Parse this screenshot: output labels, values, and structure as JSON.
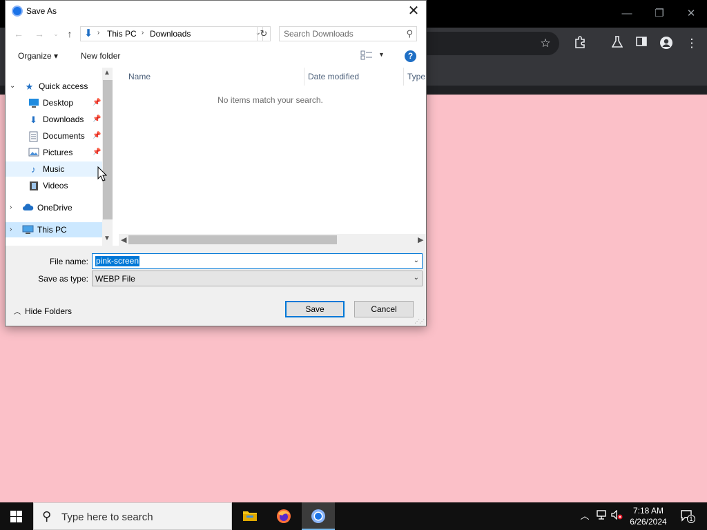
{
  "browser": {
    "window_controls": {
      "minimize": "—",
      "restore": "❐",
      "close": "✕"
    }
  },
  "dialog": {
    "title": "Save As",
    "close_glyph": "✕",
    "address": {
      "crumbs": [
        "This PC",
        "Downloads"
      ]
    },
    "search": {
      "placeholder": "Search Downloads"
    },
    "commands": {
      "organize": "Organize ▾",
      "new_folder": "New folder"
    },
    "help_glyph": "?",
    "nav_tree": {
      "quick_access": "Quick access",
      "items": [
        {
          "label": "Desktop"
        },
        {
          "label": "Downloads"
        },
        {
          "label": "Documents"
        },
        {
          "label": "Pictures"
        },
        {
          "label": "Music"
        },
        {
          "label": "Videos"
        }
      ],
      "onedrive": "OneDrive",
      "this_pc": "This PC"
    },
    "columns": {
      "name": "Name",
      "date_modified": "Date modified",
      "type": "Type"
    },
    "empty_message": "No items match your search.",
    "file_name_label": "File name:",
    "file_name_value": "pink-screen",
    "save_type_label": "Save as type:",
    "save_type_value": "WEBP File",
    "hide_folders": "Hide Folders",
    "save_button": "Save",
    "cancel_button": "Cancel"
  },
  "taskbar": {
    "search_placeholder": "Type here to search",
    "time": "7:18 AM",
    "date": "6/26/2024",
    "notification_count": "1"
  },
  "colors": {
    "page_background": "#fbc0c8",
    "selection": "#0078d7",
    "taskbar": "#101010"
  }
}
